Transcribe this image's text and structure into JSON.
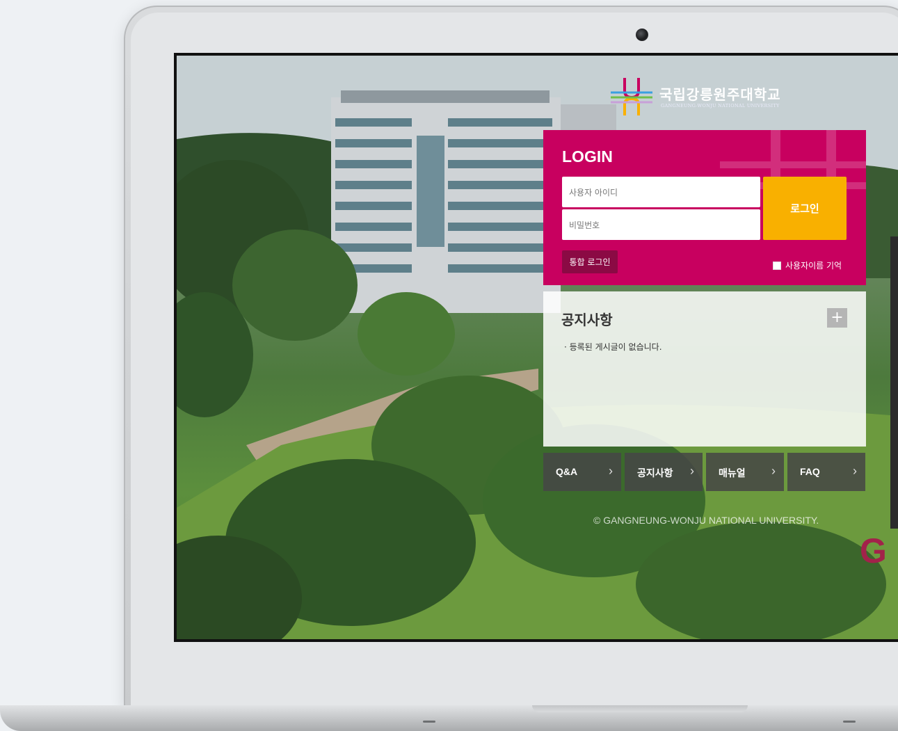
{
  "logo": {
    "title": "국립강릉원주대학교",
    "subtitle": "GANGNEUNG-WONJU NATIONAL UNIVERSITY"
  },
  "login": {
    "title": "LOGIN",
    "username_placeholder": "사용자 아이디",
    "password_placeholder": "비밀번호",
    "submit_label": "로그인",
    "sso_label": "통합 로그인",
    "remember_label": "사용자이름 기억"
  },
  "notice": {
    "title": "공지사항",
    "more_label": "+",
    "empty_message": "· 등록된 게시글이 없습니다."
  },
  "quick_links": [
    {
      "label": "Q&A"
    },
    {
      "label": "공지사항"
    },
    {
      "label": "매뉴얼"
    },
    {
      "label": "FAQ"
    }
  ],
  "footer": {
    "copyright": "© GANGNEUNG-WONJU NATIONAL UNIVERSITY.",
    "brand_mark": "G"
  },
  "colors": {
    "login_bg": "#c8005f",
    "login_button": "#f9b000",
    "sso_button": "#8b0a44"
  }
}
